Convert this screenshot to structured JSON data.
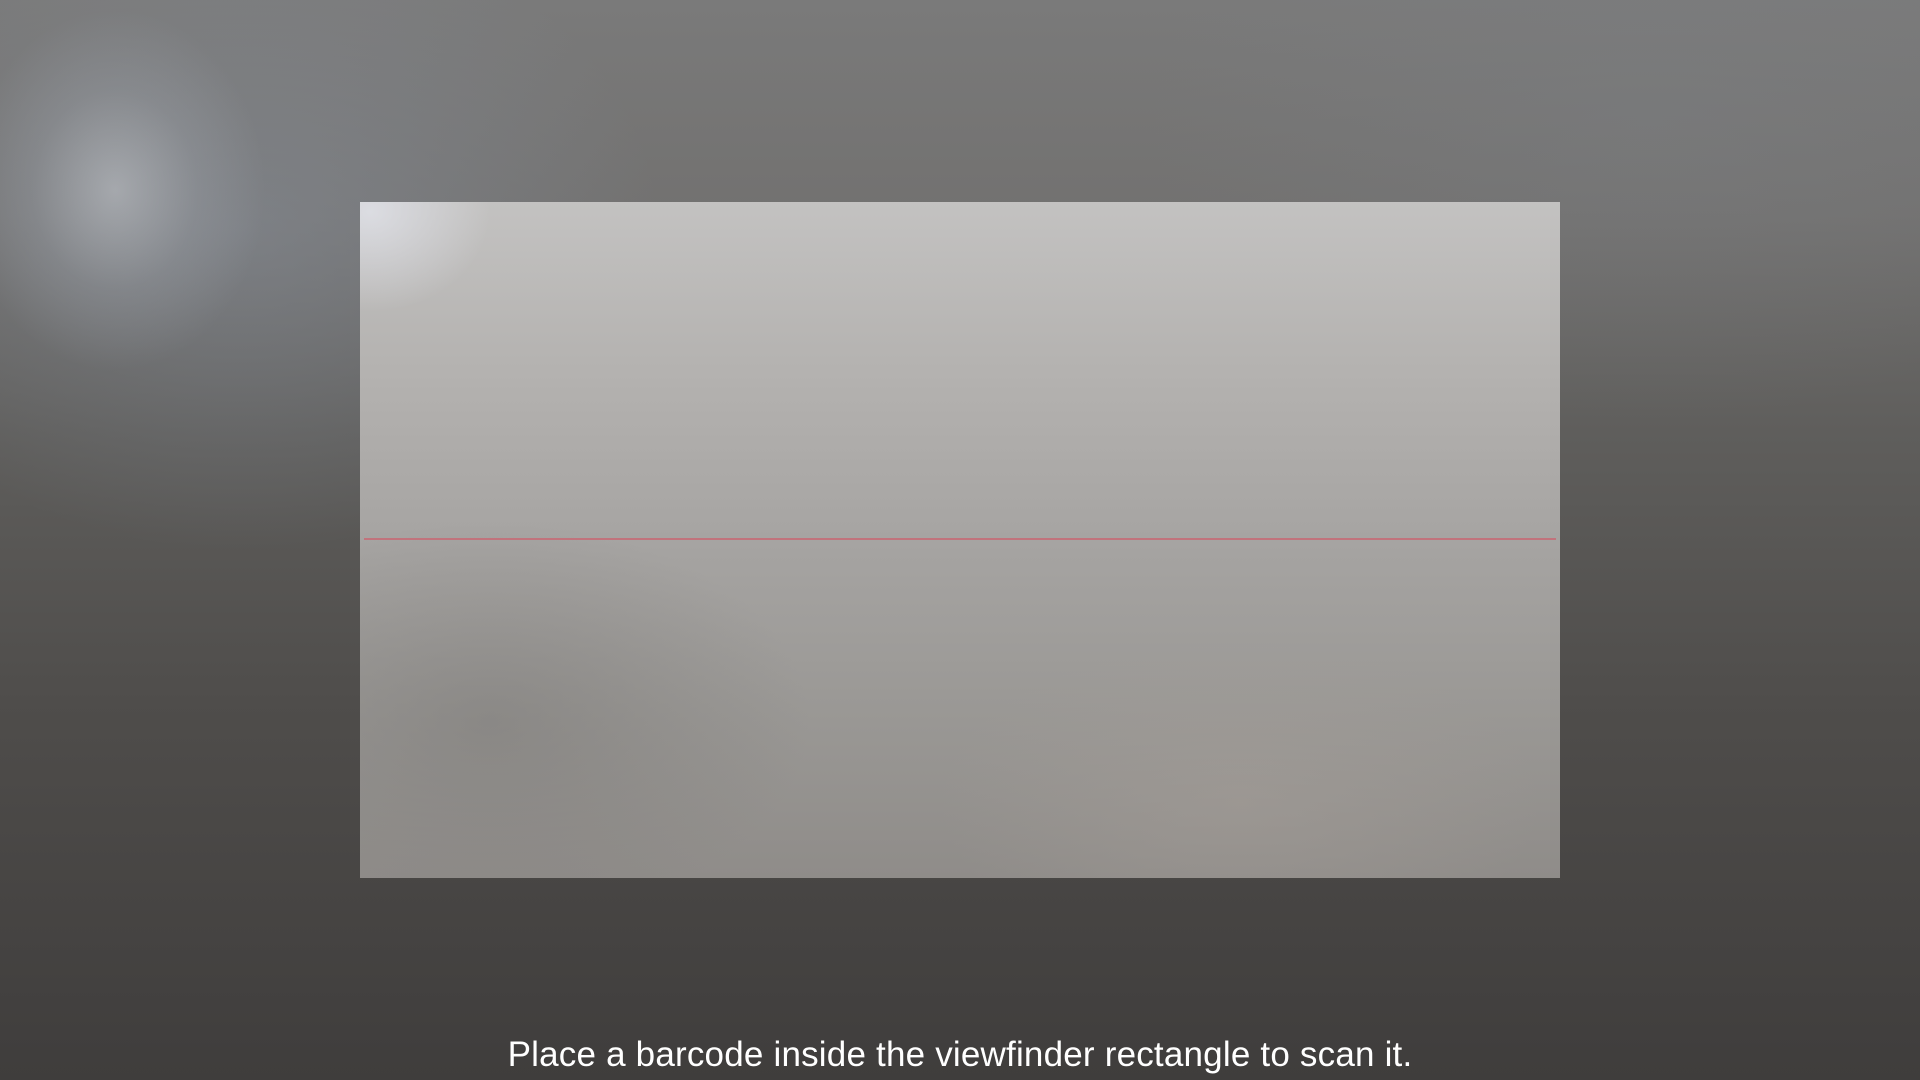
{
  "scanner": {
    "instruction": "Place a barcode inside the viewfinder rectangle to scan it.",
    "laser_color": "#c46e78"
  }
}
